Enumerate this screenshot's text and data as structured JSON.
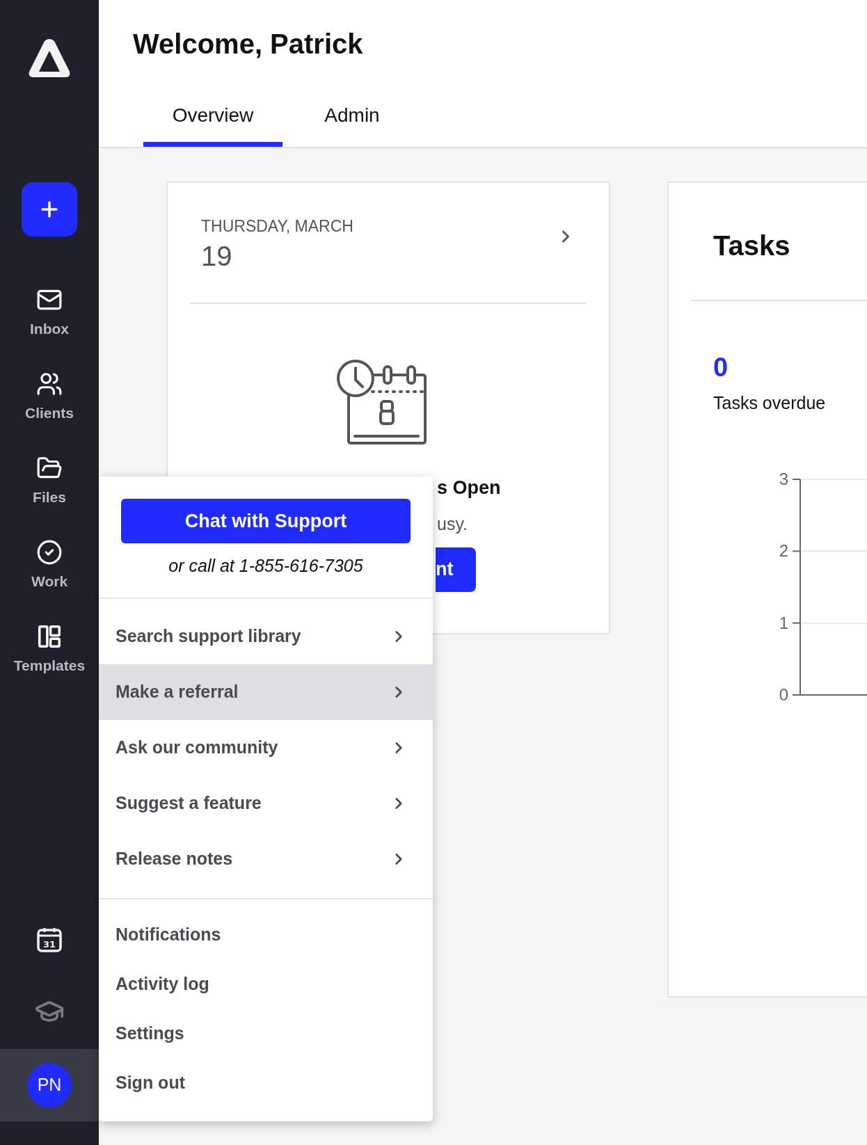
{
  "sidebar": {
    "items": [
      {
        "label": "Inbox"
      },
      {
        "label": "Clients"
      },
      {
        "label": "Files"
      },
      {
        "label": "Work"
      },
      {
        "label": "Templates"
      }
    ],
    "calendar_day": "31",
    "avatar": {
      "initials": "PN",
      "active": true
    }
  },
  "header": {
    "title": "Welcome, Patrick",
    "tabs": [
      {
        "label": "Overview",
        "selected": true
      },
      {
        "label": "Admin",
        "selected": false
      }
    ]
  },
  "schedule_card": {
    "weekday_month": "THURSDAY, MARCH",
    "day": "19",
    "title_visible": "s Open",
    "text_visible": "usy.",
    "button_visible": "nt"
  },
  "tasks_card": {
    "title": "Tasks",
    "overdue_count": "0",
    "overdue_label": "Tasks overdue",
    "axis_labels": [
      "3",
      "2",
      "1",
      "0"
    ]
  },
  "help_menu": {
    "chat_button": "Chat with Support",
    "phone_text": "or call at 1-855-616-7305",
    "support_links": [
      {
        "label": "Search support library",
        "selected": false
      },
      {
        "label": "Make a referral",
        "selected": true
      },
      {
        "label": "Ask our community",
        "selected": false
      },
      {
        "label": "Suggest a feature",
        "selected": false
      },
      {
        "label": "Release notes",
        "selected": false
      }
    ],
    "account_links": [
      {
        "label": "Notifications"
      },
      {
        "label": "Activity log"
      },
      {
        "label": "Settings"
      },
      {
        "label": "Sign out"
      }
    ]
  }
}
